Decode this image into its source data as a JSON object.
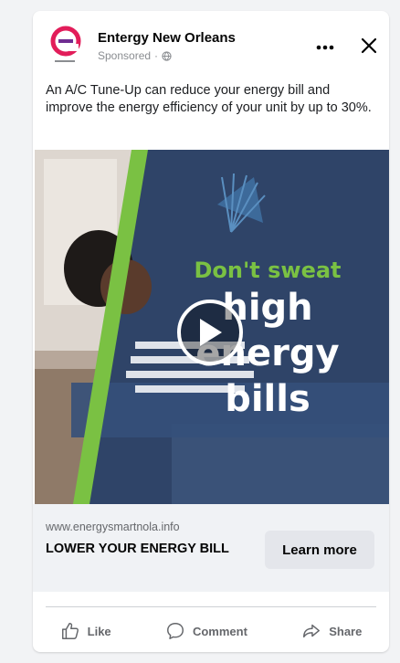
{
  "post": {
    "page_name": "Entergy New Orleans",
    "sponsored_label": "Sponsored",
    "caption": "An A/C Tune-Up can reduce your energy bill and improve the energy efficiency of your unit by up to 30%."
  },
  "media": {
    "line1": "Don't sweat",
    "line2": "high",
    "line3": "energy",
    "line4": "bills",
    "play_icon": "play-icon",
    "accent_color": "#7ac143"
  },
  "cta": {
    "domain": "www.energysmartnola.info",
    "headline": "LOWER YOUR ENERGY BILL",
    "button_label": "Learn more"
  },
  "actions": {
    "like": "Like",
    "comment": "Comment",
    "share": "Share"
  },
  "icons": {
    "more": "more-dots-icon",
    "close": "close-icon",
    "globe": "globe-icon"
  }
}
